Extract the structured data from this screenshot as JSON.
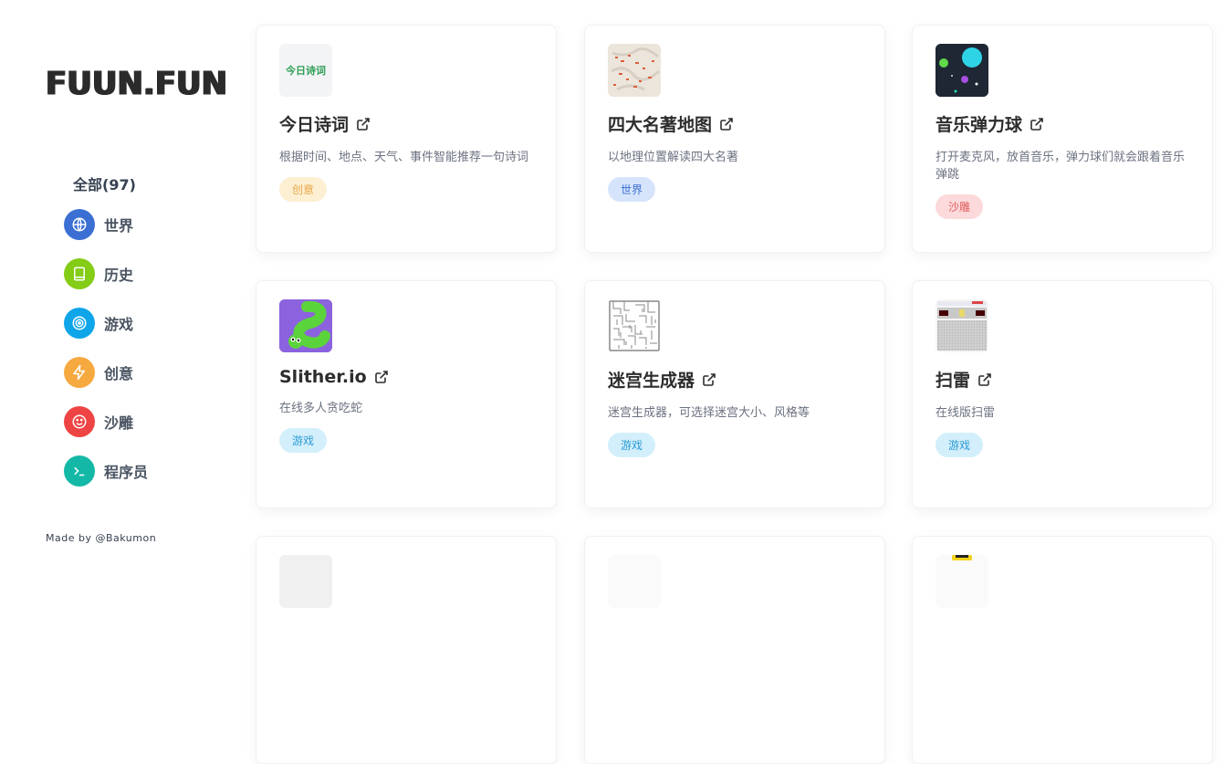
{
  "sidebar": {
    "logo": "FUUN.FUN",
    "all_label": "全部(97)",
    "items": [
      {
        "label": "世界",
        "icon": "globe-icon",
        "color": "#3b6fd3"
      },
      {
        "label": "历史",
        "icon": "book-icon",
        "color": "#84cc16"
      },
      {
        "label": "游戏",
        "icon": "target-icon",
        "color": "#0ea5e9"
      },
      {
        "label": "创意",
        "icon": "bolt-icon",
        "color": "#f5a93f"
      },
      {
        "label": "沙雕",
        "icon": "smile-icon",
        "color": "#ef4444"
      },
      {
        "label": "程序员",
        "icon": "terminal-icon",
        "color": "#14b8a6"
      }
    ],
    "credit": "Made by @Bakumon"
  },
  "cards": [
    {
      "title": "今日诗词",
      "desc": "根据时间、地点、天气、事件智能推荐一句诗词",
      "tag": "创意",
      "thumb_text": "今日诗词"
    },
    {
      "title": "四大名著地图",
      "desc": "以地理位置解读四大名著",
      "tag": "世界"
    },
    {
      "title": "音乐弹力球",
      "desc": "打开麦克风，放首音乐，弹力球们就会跟着音乐弹跳",
      "tag": "沙雕"
    },
    {
      "title": "Slither.io",
      "desc": "在线多人贪吃蛇",
      "tag": "游戏"
    },
    {
      "title": "迷宫生成器",
      "desc": "迷宫生成器，可选择迷宫大小、风格等",
      "tag": "游戏"
    },
    {
      "title": "扫雷",
      "desc": "在线版扫雷",
      "tag": "游戏"
    }
  ]
}
